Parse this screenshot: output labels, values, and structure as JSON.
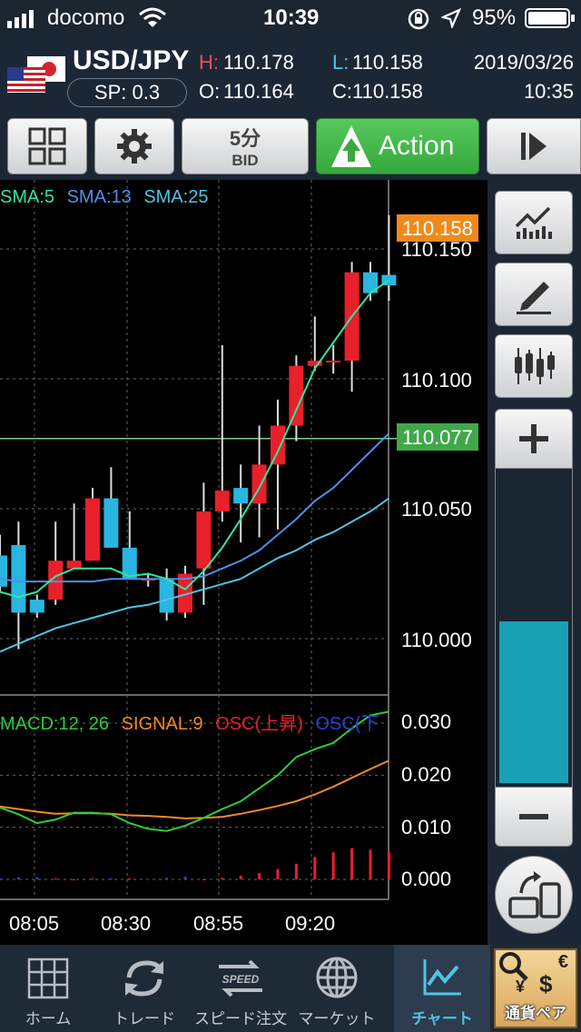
{
  "status": {
    "carrier": "docomo",
    "time": "10:39",
    "battery": "95%"
  },
  "header": {
    "pair": "USD/JPY",
    "spread": "SP: 0.3",
    "high_label": "H:",
    "high": "110.178",
    "open_label": "O:",
    "open": "110.164",
    "low_label": "L:",
    "low": "110.158",
    "close_label": "C:",
    "close": "110.158",
    "date": "2019/03/26",
    "time": "10:35"
  },
  "toolbar": {
    "timeframe": "5分",
    "price_type": "BID",
    "action_label": "Action"
  },
  "chart": {
    "sma_labels": [
      "SMA:5",
      "SMA:13",
      "SMA:25"
    ],
    "current_price": "110.158",
    "line_price": "110.077",
    "price_ticks": [
      "110.150",
      "110.100",
      "110.050",
      "110.000"
    ],
    "macd_labels": [
      "MACD:12, 26",
      "SIGNAL:9",
      "OSC(上昇)",
      "OSC(下"
    ],
    "macd_ticks": [
      "0.030",
      "0.020",
      "0.010",
      "0.000"
    ],
    "time_ticks": [
      "08:05",
      "08:30",
      "08:55",
      "09:20"
    ]
  },
  "colors": {
    "up": "#e8202a",
    "down": "#29b6e0",
    "sma5": "#2fe6a0",
    "sma13": "#4f8fe8",
    "sma25": "#4fc3e6",
    "macd": "#2ecc3a",
    "signal": "#f08a24",
    "accent_green": "#3fa94a",
    "accent_orange": "#f08a1c"
  },
  "chart_data": {
    "type": "candlestick",
    "price_ticks": [
      110.0,
      110.05,
      110.1,
      110.15
    ],
    "candles": [
      {
        "o": 110.032,
        "c": 110.02,
        "h": 110.04,
        "l": 110.018
      },
      {
        "o": 110.036,
        "c": 110.01,
        "h": 110.045,
        "l": 109.996
      },
      {
        "o": 110.015,
        "c": 110.01,
        "h": 110.017,
        "l": 110.008
      },
      {
        "o": 110.015,
        "c": 110.03,
        "h": 110.045,
        "l": 110.013
      },
      {
        "o": 110.027,
        "c": 110.03,
        "h": 110.052,
        "l": 110.027
      },
      {
        "o": 110.03,
        "c": 110.054,
        "h": 110.058,
        "l": 110.03
      },
      {
        "o": 110.054,
        "c": 110.035,
        "h": 110.066,
        "l": 110.035
      },
      {
        "o": 110.035,
        "c": 110.023,
        "h": 110.049,
        "l": 110.023
      },
      {
        "o": 110.023,
        "c": 110.023,
        "h": 110.025,
        "l": 110.02
      },
      {
        "o": 110.023,
        "c": 110.01,
        "h": 110.027,
        "l": 110.007
      },
      {
        "o": 110.01,
        "c": 110.025,
        "h": 110.028,
        "l": 110.008
      },
      {
        "o": 110.027,
        "c": 110.049,
        "h": 110.06,
        "l": 110.013
      },
      {
        "o": 110.049,
        "c": 110.057,
        "h": 110.113,
        "l": 110.045
      },
      {
        "o": 110.058,
        "c": 110.052,
        "h": 110.067,
        "l": 110.037
      },
      {
        "o": 110.052,
        "c": 110.067,
        "h": 110.082,
        "l": 110.039
      },
      {
        "o": 110.067,
        "c": 110.082,
        "h": 110.092,
        "l": 110.042
      },
      {
        "o": 110.082,
        "c": 110.105,
        "h": 110.109,
        "l": 110.076
      },
      {
        "o": 110.105,
        "c": 110.107,
        "h": 110.124,
        "l": 110.103
      },
      {
        "o": 110.107,
        "c": 110.107,
        "h": 110.113,
        "l": 110.102
      },
      {
        "o": 110.107,
        "c": 110.141,
        "h": 110.145,
        "l": 110.095
      },
      {
        "o": 110.141,
        "c": 110.133,
        "h": 110.145,
        "l": 110.13
      },
      {
        "o": 110.14,
        "c": 110.136,
        "h": 110.163,
        "l": 110.13
      }
    ],
    "sma5": [
      110.018,
      110.016,
      110.018,
      110.024,
      110.027,
      110.027,
      110.027,
      110.024,
      110.025,
      110.023,
      110.019,
      110.026,
      110.035,
      110.046,
      110.058,
      110.072,
      110.088,
      110.104,
      110.114,
      110.124,
      110.133,
      110.138
    ],
    "sma13": [
      110.023,
      110.022,
      110.022,
      110.022,
      110.022,
      110.022,
      110.023,
      110.023,
      110.023,
      110.023,
      110.023,
      110.024,
      110.027,
      110.03,
      110.034,
      110.04,
      110.046,
      110.053,
      110.058,
      110.065,
      110.072,
      110.079
    ],
    "sma25": [
      109.995,
      109.998,
      110.001,
      110.004,
      110.006,
      110.008,
      110.01,
      110.012,
      110.013,
      110.015,
      110.017,
      110.019,
      110.021,
      110.023,
      110.027,
      110.031,
      110.034,
      110.038,
      110.041,
      110.045,
      110.049,
      110.054
    ],
    "macd_ticks": [
      0.0,
      0.01,
      0.02,
      0.03
    ],
    "macd": [
      0.0138,
      0.0125,
      0.0108,
      0.0115,
      0.0128,
      0.0128,
      0.0125,
      0.0108,
      0.0097,
      0.0093,
      0.0103,
      0.0118,
      0.0135,
      0.015,
      0.0175,
      0.02,
      0.0235,
      0.025,
      0.0262,
      0.029,
      0.0315,
      0.0322
    ],
    "signal": [
      0.014,
      0.0135,
      0.013,
      0.0126,
      0.0127,
      0.0127,
      0.0126,
      0.0123,
      0.0122,
      0.012,
      0.0117,
      0.0118,
      0.012,
      0.0126,
      0.0133,
      0.0141,
      0.015,
      0.0163,
      0.0178,
      0.0195,
      0.0212,
      0.0228
    ],
    "osc": [
      -0.0002,
      -0.0004,
      -0.0004,
      0.0002,
      0.0,
      0.0002,
      -0.0002,
      0.0002,
      -0.0001,
      -0.0003,
      -0.0005,
      0.0,
      0.0003,
      0.0007,
      0.0012,
      0.002,
      0.003,
      0.0043,
      0.0052,
      0.006,
      0.0057,
      0.0053
    ],
    "time_ticks": [
      "08:05",
      "08:30",
      "08:55",
      "09:20"
    ]
  },
  "side": {
    "zoom_level": 0.52
  },
  "nav": {
    "items": [
      {
        "label": "ホーム"
      },
      {
        "label": "トレード"
      },
      {
        "label": "スピード注文"
      },
      {
        "label": "マーケット"
      },
      {
        "label": "チャート"
      },
      {
        "label": "通貨ペア"
      }
    ],
    "speed_badge": "SPEED",
    "currency_symbols": [
      "€",
      "¥",
      "$"
    ]
  }
}
